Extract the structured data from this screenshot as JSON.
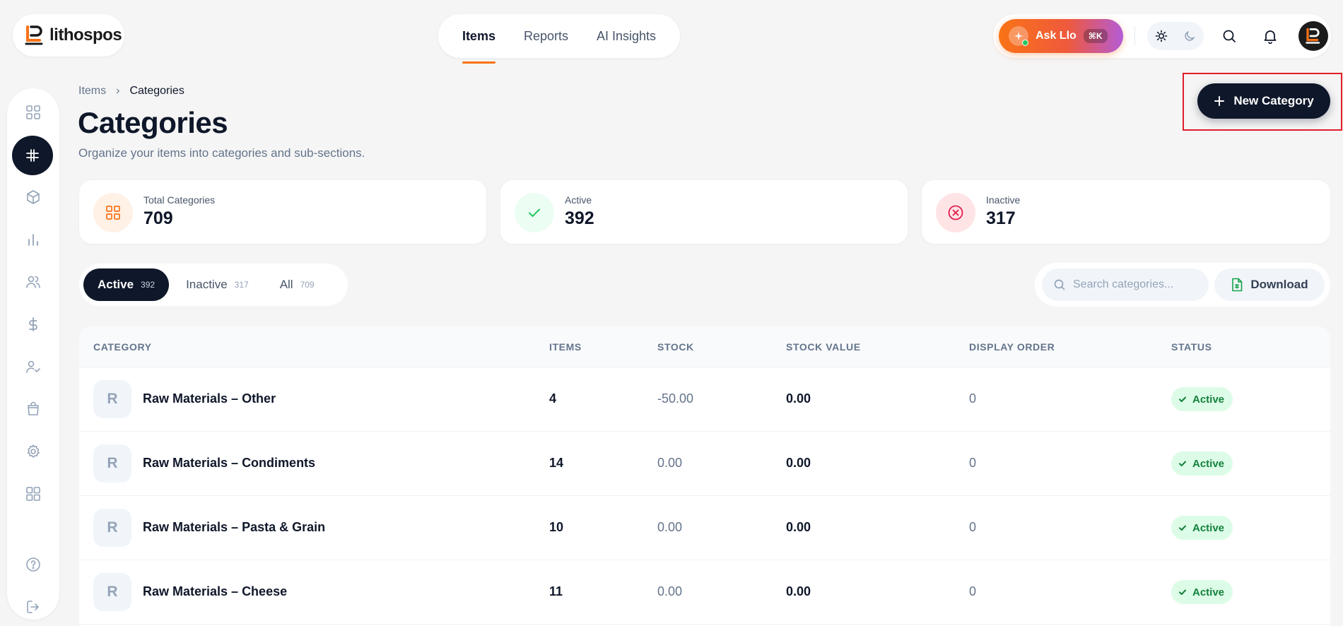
{
  "brand": {
    "name": "lithospos"
  },
  "nav": {
    "tabs": [
      {
        "label": "Items"
      },
      {
        "label": "Reports"
      },
      {
        "label": "AI Insights"
      }
    ]
  },
  "topbar": {
    "ask_label": "Ask Llo",
    "ask_shortcut": "⌘K"
  },
  "breadcrumb": {
    "parent": "Items",
    "separator": "›",
    "current": "Categories"
  },
  "page": {
    "title": "Categories",
    "subtitle": "Organize your items into categories and sub-sections."
  },
  "actions": {
    "new_label": "New Category"
  },
  "stats": [
    {
      "label": "Total Categories",
      "value": "709"
    },
    {
      "label": "Active",
      "value": "392"
    },
    {
      "label": "Inactive",
      "value": "317"
    }
  ],
  "filters": [
    {
      "label": "Active",
      "count": "392"
    },
    {
      "label": "Inactive",
      "count": "317"
    },
    {
      "label": "All",
      "count": "709"
    }
  ],
  "search": {
    "placeholder": "Search categories..."
  },
  "download_label": "Download",
  "table": {
    "columns": [
      "CATEGORY",
      "ITEMS",
      "STOCK",
      "STOCK VALUE",
      "DISPLAY ORDER",
      "STATUS"
    ],
    "rows": [
      {
        "initial": "R",
        "name": "Raw Materials – Other",
        "items": "4",
        "stock": "-50.00",
        "value": "0.00",
        "order": "0",
        "status": "Active"
      },
      {
        "initial": "R",
        "name": "Raw Materials – Condiments",
        "items": "14",
        "stock": "0.00",
        "value": "0.00",
        "order": "0",
        "status": "Active"
      },
      {
        "initial": "R",
        "name": "Raw Materials – Pasta & Grain",
        "items": "10",
        "stock": "0.00",
        "value": "0.00",
        "order": "0",
        "status": "Active"
      },
      {
        "initial": "R",
        "name": "Raw Materials – Cheese",
        "items": "11",
        "stock": "0.00",
        "value": "0.00",
        "order": "0",
        "status": "Active"
      }
    ]
  },
  "colors": {
    "accent": "#f97316",
    "primary": "#0f172a",
    "success": "#15803d",
    "danger": "#e11d48"
  }
}
